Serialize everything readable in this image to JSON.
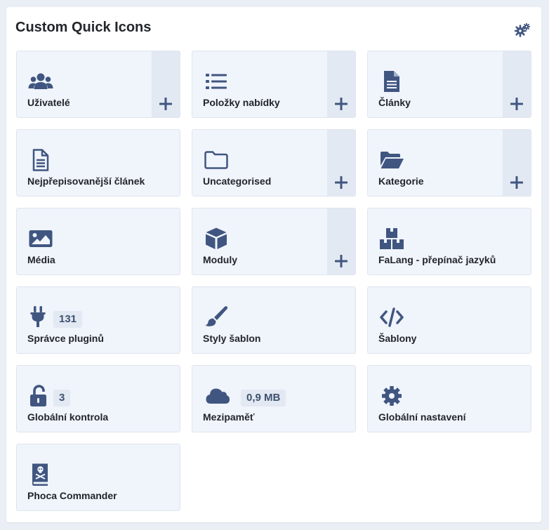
{
  "panel": {
    "title": "Custom Quick Icons",
    "settings_icon": "gear-icon"
  },
  "colors": {
    "icon": "#405680",
    "tile_bg": "#f0f4fb",
    "add_bg": "#e3e9f2",
    "badge_text": "#3e5170"
  },
  "tiles": [
    {
      "label": "Uživatelé",
      "icon": "users-icon",
      "add": true
    },
    {
      "label": "Položky nabídky",
      "icon": "list-icon",
      "add": true
    },
    {
      "label": "Články",
      "icon": "file-text-icon",
      "add": true
    },
    {
      "label": "Nejpřepisovanější článek",
      "icon": "file-outline-icon",
      "add": false
    },
    {
      "label": "Uncategorised",
      "icon": "folder-outline-icon",
      "add": true
    },
    {
      "label": "Kategorie",
      "icon": "folder-open-icon",
      "add": true
    },
    {
      "label": "Média",
      "icon": "image-icon",
      "add": false
    },
    {
      "label": "Moduly",
      "icon": "cube-icon",
      "add": true
    },
    {
      "label": "FaLang - přepínač jazyků",
      "icon": "boxes-icon",
      "add": false
    },
    {
      "label": "Správce pluginů",
      "icon": "plug-icon",
      "add": false,
      "badge": "131"
    },
    {
      "label": "Styly šablon",
      "icon": "paint-brush-icon",
      "add": false
    },
    {
      "label": "Šablony",
      "icon": "code-icon",
      "add": false
    },
    {
      "label": "Globální kontrola",
      "icon": "unlock-icon",
      "add": false,
      "badge": "3"
    },
    {
      "label": "Mezipaměť",
      "icon": "cloud-icon",
      "add": false,
      "badge": "0,9 MB"
    },
    {
      "label": "Globální nastavení",
      "icon": "cog-icon",
      "add": false
    },
    {
      "label": "Phoca Commander",
      "icon": "book-skull-icon",
      "add": false
    }
  ]
}
